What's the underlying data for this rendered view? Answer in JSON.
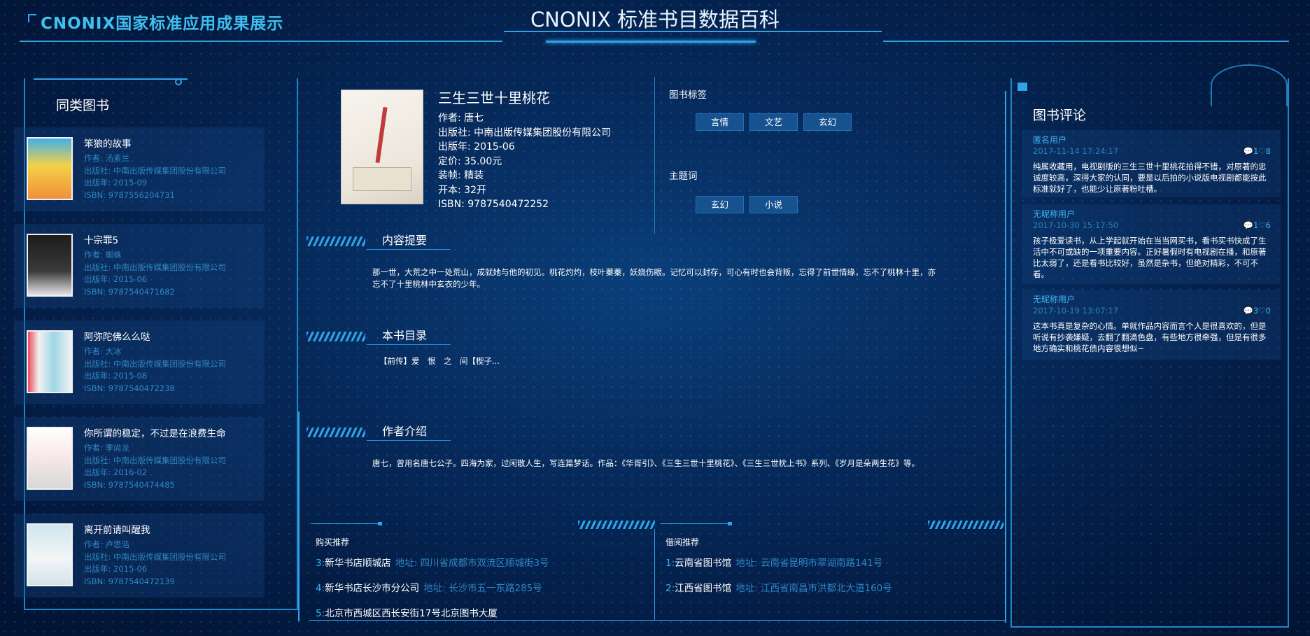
{
  "header": {
    "brand": "CNONIX国家标准应用成果展示",
    "title": "CNONIX 标准书目数据百科"
  },
  "similar_books": {
    "title": "同类图书",
    "items": [
      {
        "title": "笨狼的故事",
        "author": "作者: 汤素兰",
        "publisher": "出版社: 中南出版传媒集团股份有限公司",
        "year": "出版年: 2015-09",
        "isbn": "ISBN: 9787556204731"
      },
      {
        "title": "十宗罪5",
        "author": "作者: 蜘蛛",
        "publisher": "出版社: 中南出版传媒集团股份有限公司",
        "year": "出版年: 2015-06",
        "isbn": "ISBN: 9787540471682"
      },
      {
        "title": "阿弥陀佛么么哒",
        "author": "作者: 大冰",
        "publisher": "出版社: 中南出版传媒集团股份有限公司",
        "year": "出版年: 2015-08",
        "isbn": "ISBN: 9787540472238"
      },
      {
        "title": "你所谓的稳定，不过是在浪费生命",
        "author": "作者: 李尚龙",
        "publisher": "出版社: 中南出版传媒集团股份有限公司",
        "year": "出版年: 2016-02",
        "isbn": "ISBN: 9787540474485"
      },
      {
        "title": "离开前请叫醒我",
        "author": "作者: 卢思浩",
        "publisher": "出版社: 中南出版传媒集团股份有限公司",
        "year": "出版年: 2015-06",
        "isbn": "ISBN: 9787540472139"
      }
    ]
  },
  "book": {
    "title": "三生三世十里桃花",
    "author": "作者: 唐七",
    "publisher": "出版社: 中南出版传媒集团股份有限公司",
    "year": "出版年: 2015-06",
    "price": "定价: 35.00元",
    "binding": "装帧: 精装",
    "format": "开本: 32开",
    "isbn": "ISBN: 9787540472252"
  },
  "tags": {
    "label": "图书标签",
    "items": [
      "言情",
      "文艺",
      "玄幻"
    ]
  },
  "subjects": {
    "label": "主题词",
    "items": [
      "玄幻",
      "小说"
    ]
  },
  "sections": {
    "summary_title": "内容提要",
    "summary_text": "那一世，大荒之中一处荒山，成就她与他的初见。桃花灼灼，枝叶蓁蓁，妖娆伤眼。记忆可以封存，可心有时也会背叛，忘得了前世情缘，忘不了桃林十里，亦忘不了十里桃林中玄衣的少年。",
    "toc_title": "本书目录",
    "toc_text": "【前传】爱　恨　之　间【楔子...",
    "author_title": "作者介绍",
    "author_text": "唐七，曾用名唐七公子。四海为家，过闲散人生，写连篇梦话。作品：《华胥引》、《三生三世十里桃花》、《三生三世枕上书》系列、《岁月是朵两生花》等。"
  },
  "purchase": {
    "title": "购买推荐",
    "items": [
      {
        "num": "3:",
        "name": "新华书店顺城店",
        "addr": "地址: 四川省成都市双流区顺城街3号"
      },
      {
        "num": "4:",
        "name": "新华书店长沙市分公司",
        "addr": "地址: 长沙市五一东路285号"
      },
      {
        "num": "5:",
        "name": "北京市西城区西长安街17号北京图书大厦",
        "addr": ""
      }
    ]
  },
  "borrow": {
    "title": "借阅推荐",
    "items": [
      {
        "num": "1:",
        "name": "云南省图书馆",
        "addr": "地址: 云南省昆明市翠湖南路141号"
      },
      {
        "num": "2:",
        "name": "江西省图书馆",
        "addr": "地址: 江西省南昌市洪都北大道160号"
      }
    ]
  },
  "comments": {
    "title": "图书评论",
    "items": [
      {
        "user": "匿名用户",
        "time": "2017-11-14 17:24:17",
        "stats": "💬1♡8",
        "text": "纯属收藏用，电视剧版的三生三世十里桃花拍得不错，对原著的忠诚度较高，深得大家的认同，要是以后拍的小说版电视剧都能按此标准就好了，也能少让原著粉吐槽。"
      },
      {
        "user": "无昵称用户",
        "time": "2017-10-30 15:17:50",
        "stats": "💬1♡6",
        "text": "孩子极爱读书，从上学起就开始在当当网买书，看书买书快成了生活中不可或缺的一项重要内容。正好暑假时有电视剧在播，和原著比太弱了，还是看书比较好，虽然是杂书，但绝对精彩，不可不看。"
      },
      {
        "user": "无昵称用户",
        "time": "2017-10-19 13:07:17",
        "stats": "💬3♡0",
        "text": "这本书真是复杂的心情。单就作品内容而言个人是很喜欢的，但是听说有抄袭嫌疑，去翻了翻滴色盘，有些地方很牵强，但是有很多地方确实和桃花债内容很想似~"
      }
    ]
  },
  "colors": {
    "accent": "#2fa3e8",
    "background": "#06295a",
    "muted_text": "#2d87c2"
  }
}
